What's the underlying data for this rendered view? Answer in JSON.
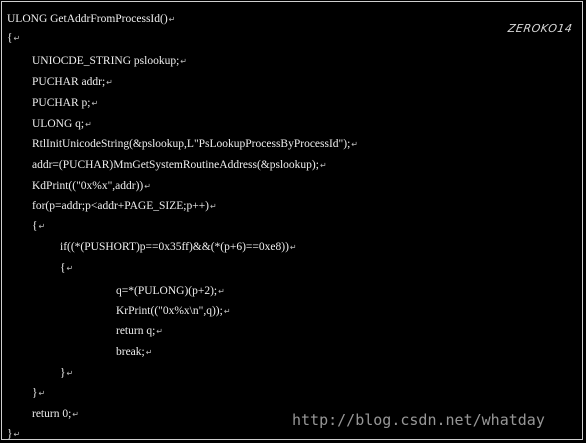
{
  "signature": "ZEROKO14",
  "paragraph_mark": "↵",
  "code_lines": [
    "ULONG GetAddrFromProcessId()",
    "{",
    "UNIOCDE_STRING pslookup;",
    "PUCHAR addr;",
    "PUCHAR p;",
    "ULONG q;",
    "RtlInitUnicodeString(&pslookup,L\"PsLookupProcessByProcessId\");",
    "addr=(PUCHAR)MmGetSystemRoutineAddress(&pslookup);",
    "KdPrint((\"0x%x\",addr))",
    "for(p=addr;p<addr+PAGE_SIZE;p++)",
    "{",
    "if((*(PUSHORT)p==0x35ff)&&(*(p+6)==0xe8))",
    "{",
    "q=*(PULONG)(p+2);",
    "KrPrint((\"0x%x\\n\",q));",
    "return q;",
    "break;",
    "}",
    "}",
    "return 0;",
    "}"
  ],
  "watermark": "http://blog.csdn.net/whatday"
}
